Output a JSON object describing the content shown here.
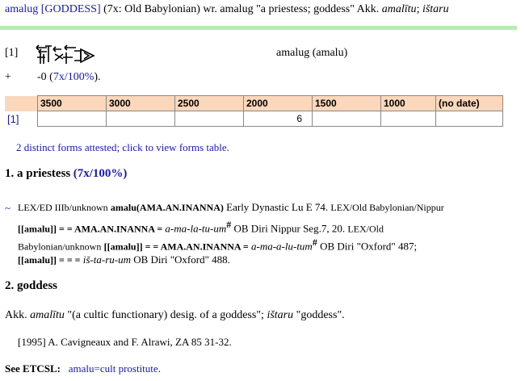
{
  "header": {
    "lemma": "amalug",
    "pos": "[GODDESS]",
    "attest": "(7x: Old Babylonian) wr. amalug \"a priestess; goddess\" Akk.",
    "akk1": "amalītu",
    "sep": ";",
    "akk2": "ištaru"
  },
  "form_row": {
    "index": "[1]",
    "sign_icon": "cuneiform-sign-icon",
    "reading": "amalug (amalu)"
  },
  "summary": {
    "plus": "+",
    "prefix": "-0 (",
    "pct": "7x/100%",
    "suffix": ")."
  },
  "periods_table": {
    "headers": [
      "3500",
      "3000",
      "2500",
      "2000",
      "1500",
      "1000",
      "(no date)"
    ],
    "row_label": "[1]",
    "values": [
      "",
      "",
      "",
      "6",
      "",
      "",
      ""
    ]
  },
  "forms_link": "2 distinct forms attested; click to view forms table.",
  "sense1": {
    "title": "1. a priestess",
    "pct": "(7x/100%)",
    "tilde": "~",
    "l1_a": "LEX/ED IIIb/unknown",
    "l1_b": "amalu(AMA.AN.INANNA)",
    "l1_c": "Early Dynastic Lu E 74.",
    "l1_d": "LEX/Old Babylonian/Nippur",
    "l2_a": "[[amalu]] = = AMA.AN.INANNA =",
    "l2_b": "a-ma-la-tu-um",
    "l2_sup": "#",
    "l2_c": "OB Diri Nippur Seg.7, 20.",
    "l2_d": "LEX/Old",
    "l3_a": "Babylonian/unknown",
    "l3_b": "[[amalu]] = = AMA.AN.INANNA =",
    "l3_c": "a-ma-a-lu-tum",
    "l3_sup": "#",
    "l3_d": "OB Diri \"Oxford\" 487;",
    "l4_a": "[[amalu]] = = =",
    "l4_b": "iš-ta-ru-um",
    "l4_c": "OB Diri \"Oxford\" 488."
  },
  "sense2": {
    "title": "2. goddess",
    "akk_pre": "Akk.",
    "akk1": "amalītu",
    "akk1_gloss": "\"(a cultic functionary) desig. of a goddess\";",
    "akk2": "ištaru",
    "akk2_gloss": "\"goddess\"."
  },
  "bibliography": "[1995] A. Cavigneaux and F. Alrawi, ZA 85 31-32.",
  "etcsl": {
    "label": "See ETCSL:",
    "link": "amalu=cult prostitute",
    "end": "."
  }
}
